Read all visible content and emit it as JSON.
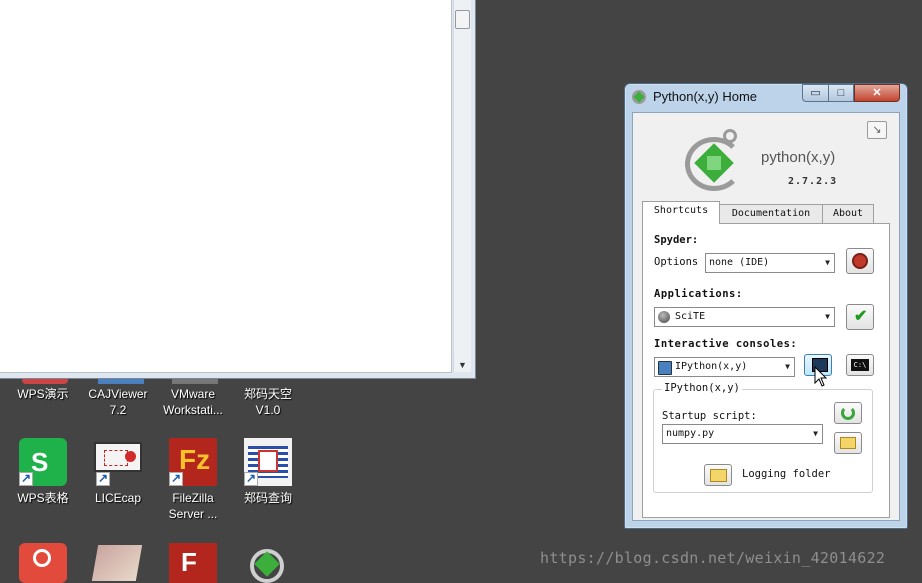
{
  "desktop": {
    "icons": [
      {
        "label": "WPS演示",
        "color": "#e04a2a"
      },
      {
        "label": "CAJViewer 7.2",
        "color": "#3a6fb0"
      },
      {
        "label": "VMware Workstati...",
        "color": "#6b6b6b"
      },
      {
        "label": "郑码天空 V1.0",
        "color": "#c04040"
      },
      {
        "label": "WPS表格",
        "color": "#1fb14a"
      },
      {
        "label": "LICEcap",
        "color": "#d12b2b"
      },
      {
        "label": "FileZilla Server ...",
        "color": "#b3261e"
      },
      {
        "label": "郑码查询",
        "color": "#2a4fa8"
      }
    ]
  },
  "window": {
    "title": "Python(x,y) Home",
    "close_glyph": "✕",
    "min_glyph": "▭",
    "max_glyph": "□",
    "logo_text": "python(x,y)",
    "version": "2.7.2.3",
    "tabs": [
      "Shortcuts",
      "Documentation",
      "About"
    ],
    "active_tab": "Shortcuts"
  },
  "shortcuts": {
    "spyder_heading": "Spyder:",
    "options_label": "Options",
    "options_value": "none (IDE)",
    "applications_heading": "Applications:",
    "applications_value": "SciTE",
    "consoles_heading": "Interactive consoles:",
    "consoles_value": "IPython(x,y)",
    "ipython_group": "IPython(x,y)",
    "startup_label": "Startup script:",
    "startup_value": "numpy.py",
    "logging_label": "Logging folder"
  },
  "watermark": "https://blog.csdn.net/weixin_42014622"
}
